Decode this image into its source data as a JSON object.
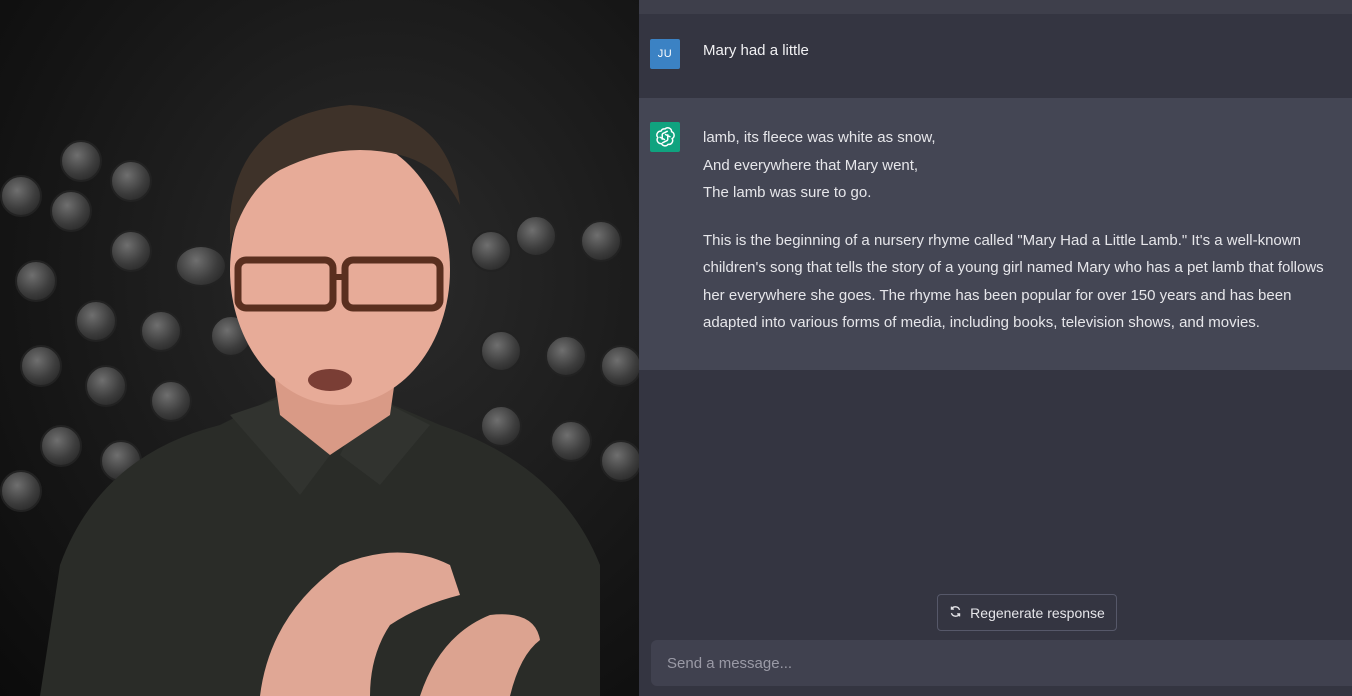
{
  "video": {
    "description_icon": "webcam-presenter"
  },
  "conversation": {
    "user": {
      "avatar_initials": "JU",
      "message": "Mary had a little"
    },
    "assistant": {
      "avatar_icon": "openai-logo-icon",
      "poem_lines": [
        "lamb, its fleece was white as snow,",
        "And everywhere that Mary went,",
        "The lamb was sure to go."
      ],
      "explanation": "This is the beginning of a nursery rhyme called \"Mary Had a Little Lamb.\" It's a well-known children's song that tells the story of a young girl named Mary who has a pet lamb that follows her everywhere she goes. The rhyme has been popular for over 150 years and has been adapted into various forms of media, including books, television shows, and movies."
    }
  },
  "controls": {
    "regenerate_label": "Regenerate response",
    "regenerate_icon": "refresh-icon",
    "input_placeholder": "Send a message..."
  },
  "colors": {
    "background": "#343541",
    "assistant_row": "#444654",
    "user_avatar": "#3b82c4",
    "assistant_avatar": "#10a37f",
    "input_bg": "#40414f"
  }
}
